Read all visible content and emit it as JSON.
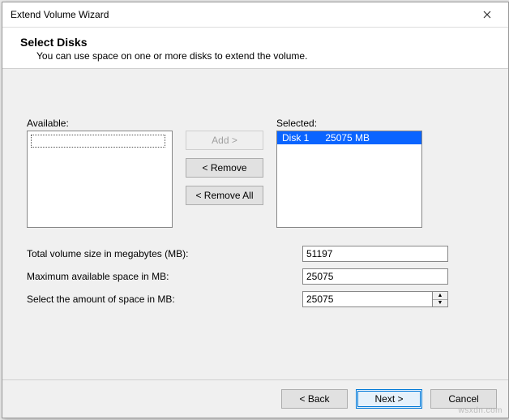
{
  "window": {
    "title": "Extend Volume Wizard"
  },
  "header": {
    "heading": "Select Disks",
    "subtitle": "You can use space on one or more disks to extend the volume."
  },
  "lists": {
    "available_label": "Available:",
    "selected_label": "Selected:",
    "selected_items": [
      {
        "text": "Disk 1      25075 MB",
        "selected": true
      }
    ]
  },
  "buttons": {
    "add": "Add >",
    "remove": "< Remove",
    "remove_all": "< Remove All",
    "back": "< Back",
    "next": "Next >",
    "cancel": "Cancel"
  },
  "fields": {
    "total_label": "Total volume size in megabytes (MB):",
    "total_value": "51197",
    "max_label": "Maximum available space in MB:",
    "max_value": "25075",
    "select_label": "Select the amount of space in MB:",
    "select_value": "25075"
  },
  "watermark": "wsxdn.com"
}
